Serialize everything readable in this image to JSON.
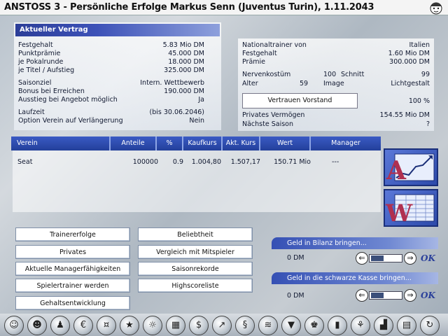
{
  "window": {
    "title": "ANSTOSS 3 - Persönliche Erfolge Markus Senn (Juventus Turin), 1.11.2043",
    "face_icon": "face-icon"
  },
  "contract": {
    "header": "Aktueller Vertrag",
    "rows": [
      {
        "label": "Festgehalt",
        "value": "5.83 Mio DM"
      },
      {
        "label": "Punktprämie",
        "value": "45.000 DM"
      },
      {
        "label": "je Pokalrunde",
        "value": "18.000 DM"
      },
      {
        "label": "je Titel / Aufstieg",
        "value": "325.000 DM"
      },
      {
        "label": "Saisonziel",
        "value": "Intern. Wettbewerb"
      },
      {
        "label": "Bonus bei Erreichen",
        "value": "190.000 DM"
      },
      {
        "label": "Ausstieg bei Angebot möglich",
        "value": "Ja"
      },
      {
        "label": "Laufzeit",
        "value": "(bis 30.06.2046)"
      },
      {
        "label": "Option Verein auf Verlängerung",
        "value": "Nein"
      }
    ]
  },
  "national": {
    "nationaltrainer_label": "Nationaltrainer von",
    "nationaltrainer_value": "Italien",
    "festgehalt_label": "Festgehalt",
    "festgehalt_value": "1.60 Mio DM",
    "praemie_label": "Prämie",
    "praemie_value": "300.000 DM",
    "nerven_label": "Nervenkostüm",
    "nerven_value": "100",
    "schnitt_label": "Schnitt",
    "schnitt_value": "99",
    "alter_label": "Alter",
    "alter_value": "59",
    "image_label": "Image",
    "image_value": "Lichtgestalt",
    "trust_button": "Vertrauen Vorstand",
    "trust_value": "100 %",
    "vermoegen_label": "Privates Vermögen",
    "vermoegen_value": "154.55 Mio DM",
    "saison_label": "Nächste Saison",
    "saison_value": "?"
  },
  "table": {
    "headers": [
      "Verein",
      "Anteile",
      "%",
      "Kaufkurs",
      "Akt. Kurs",
      "Wert",
      "Manager"
    ],
    "rows": [
      [
        "Seat",
        "100000",
        "0.9",
        "1.004,80",
        "1.507,17",
        "150.71 Mio",
        "---"
      ]
    ]
  },
  "buttons": {
    "trainererfolge": "Trainererfolge",
    "beliebtheit": "Beliebtheit",
    "privates": "Privates",
    "vergleich": "Vergleich mit Mitspieler",
    "managerfaehigkeiten": "Aktuelle Managerfähigkeiten",
    "saisonrekorde": "Saisonrekorde",
    "spielertrainer": "Spielertrainer werden",
    "highscoreliste": "Highscoreliste",
    "gehaltsentwicklung": "Gehaltsentwicklung"
  },
  "money": {
    "bilanz_label": "Geld in Bilanz bringen...",
    "bilanz_value": "0 DM",
    "kasse_label": "Geld in die schwarze Kasse bringen...",
    "kasse_value": "0 DM",
    "ok_label": "OK",
    "left_arrow": "⇐",
    "right_arrow": "⇒"
  },
  "toolbar": {
    "icons": [
      "person-icon",
      "team-icon",
      "tactics-board-icon",
      "transfer-icon",
      "finance-icon",
      "success-icon",
      "settings-icon",
      "calendar-icon",
      "money-icon",
      "stocks-icon",
      "sponsor-icon",
      "flags-icon",
      "press-icon",
      "trainer-icon",
      "statistics-icon",
      "youth-icon",
      "stock-market-icon",
      "news-icon",
      "exit-icon"
    ],
    "glyphs": [
      "☺",
      "☻",
      "♟",
      "€",
      "¤",
      "★",
      "☼",
      "▦",
      "$",
      "↗",
      "§",
      "≋",
      "▼",
      "♚",
      "▮",
      "⚘",
      "▟",
      "▤",
      "↻"
    ]
  }
}
